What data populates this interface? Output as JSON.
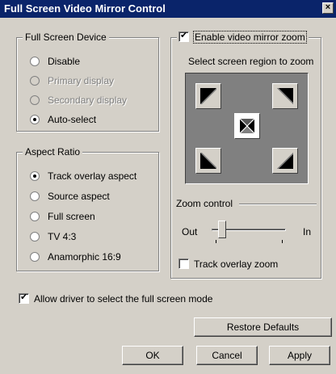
{
  "window": {
    "title": "Full Screen Video Mirror Control",
    "close_glyph": "×"
  },
  "device_group": {
    "legend": "Full Screen Device",
    "options": [
      {
        "label": "Disable",
        "selected": false,
        "disabled": false
      },
      {
        "label": "Primary display",
        "selected": false,
        "disabled": true
      },
      {
        "label": "Secondary display",
        "selected": false,
        "disabled": true
      },
      {
        "label": "Auto-select",
        "selected": true,
        "disabled": false
      }
    ]
  },
  "aspect_group": {
    "legend": "Aspect Ratio",
    "options": [
      {
        "label": "Track overlay aspect",
        "selected": true
      },
      {
        "label": "Source aspect",
        "selected": false
      },
      {
        "label": "Full screen",
        "selected": false
      },
      {
        "label": "TV 4:3",
        "selected": false
      },
      {
        "label": "Anamorphic 16:9",
        "selected": false
      }
    ]
  },
  "zoom_group": {
    "enable_label": "Enable video mirror zoom",
    "enable_checked": true,
    "region_label": "Select screen region to zoom",
    "zoom_control_label": "Zoom control",
    "out_label": "Out",
    "in_label": "In",
    "slider_position": 0.1,
    "track_overlay_label": "Track overlay zoom",
    "track_overlay_checked": false
  },
  "allow_driver": {
    "label": "Allow driver to select the full screen mode",
    "checked": true
  },
  "buttons": {
    "restore": "Restore Defaults",
    "ok": "OK",
    "cancel": "Cancel",
    "apply": "Apply"
  }
}
